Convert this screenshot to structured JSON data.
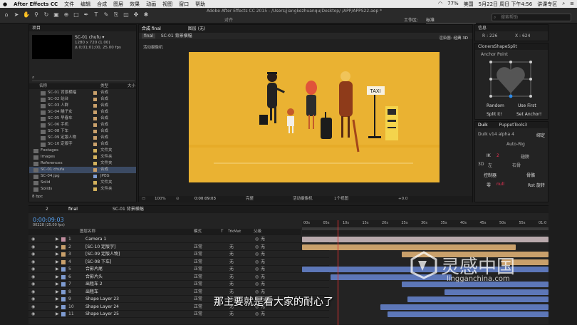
{
  "menubar": {
    "app": "After Effects CC",
    "items": [
      "文件",
      "编辑",
      "合成",
      "图层",
      "效果",
      "动画",
      "视图",
      "窗口",
      "帮助"
    ],
    "status": "77%",
    "lang": "美国",
    "datetime": "5月22日 周日 下午4:56",
    "user": "讲课专区"
  },
  "window_title": "Adobe After Effects CC 2015 - /Users/jiangkezhuanqu/Desktop/ /APP/APPS22.aep *",
  "toolbar": {
    "snap": "对齐",
    "workspace_label": "工作区:",
    "workspace": "标准",
    "search_placeholder": "搜索帮助"
  },
  "project": {
    "title": "项目",
    "comp_name": "SC-01 chufu ▾",
    "comp_info1": "1280 x 720 (1.00)",
    "comp_info2": "Δ 0;01;01;00, 25.00 fps",
    "col_name": "名称",
    "col_type": "类型",
    "col_size": "大小",
    "items": [
      {
        "name": "SC-01 背景横幅",
        "type": "合成",
        "color": "#c9a06b"
      },
      {
        "name": "SC-02 站台",
        "type": "合成",
        "color": "#c9a06b"
      },
      {
        "name": "SC-03 人群",
        "type": "合成",
        "color": "#c9a06b"
      },
      {
        "name": "SC-04 瞄子女",
        "type": "合成",
        "color": "#c9a06b"
      },
      {
        "name": "SC-05 早春车",
        "type": "合成",
        "color": "#c9a06b"
      },
      {
        "name": "SC-06 手机",
        "type": "合成",
        "color": "#c9a06b"
      },
      {
        "name": "SC-08 下车",
        "type": "合成",
        "color": "#c9a06b"
      },
      {
        "name": "SC-09 定版人物",
        "type": "合成",
        "color": "#c9a06b"
      },
      {
        "name": "SC-10 定版字",
        "type": "合成",
        "color": "#c9a06b"
      },
      {
        "name": "Footages",
        "type": "文件夹",
        "color": "#d2b15c"
      },
      {
        "name": "Images",
        "type": "文件夹",
        "color": "#d2b15c"
      },
      {
        "name": "References",
        "type": "文件夹",
        "color": "#d2b15c"
      },
      {
        "name": "SC-01 chufa",
        "type": "合成",
        "color": "#c9a06b"
      },
      {
        "name": "SC-04.jpg",
        "type": "JPEG",
        "color": "#7f9cd1"
      },
      {
        "name": "Solid",
        "type": "文件夹",
        "color": "#d2b15c"
      },
      {
        "name": "Solids",
        "type": "文件夹",
        "color": "#d2b15c"
      }
    ],
    "footer": "8 bpc"
  },
  "composition": {
    "tab_final": "final",
    "tab_label": "合成 final",
    "tab2": "图层 (无)",
    "sub_tab": "SC-01 背景横幅",
    "side_label": "活动摄像机",
    "renderer_label": "渲染器:",
    "renderer": "经典 3D",
    "taxi": "TAXI",
    "zoom": "100%",
    "timecode": "0:00:09:03",
    "quality": "完整",
    "camera": "活动摄像机",
    "views": "1个视图",
    "offset": "+0.0"
  },
  "info": {
    "title": "信息",
    "r": "R : 226",
    "x": "X : 624"
  },
  "shapesplit": {
    "title": "ClonersShapeSplit",
    "anchor": "Anchor Point",
    "random": "Random",
    "use_first": "Use First",
    "split_it": "Split it!",
    "set_anchor": "Set Anchor!"
  },
  "duik": {
    "tab1": "Duik",
    "tab2": "PuppetTools3",
    "version": "Duik v14 alpha 4",
    "bind": "绑定",
    "autorig": "Auto-Rig",
    "ik": "IK",
    "ik_val": "2",
    "wing": "翅膀",
    "threed": "3D",
    "left": "左",
    "right": "右骨",
    "controller": "控制器",
    "bone": "骨骼",
    "zero": "零",
    "zero_val": "null",
    "rot": "Rot 旋转"
  },
  "timeline": {
    "tabs": [
      "2",
      "final",
      "SC-01 背景横幅"
    ],
    "timecode": "0:00:09:03",
    "frames": "00228 (25.00 fps)",
    "col_layer": "图层名称",
    "col_mode": "模式",
    "col_t": "T",
    "col_trk": "TrkMat",
    "col_parent": "父级",
    "ruler": [
      "00s",
      "05s",
      "10s",
      "15s",
      "20s",
      "25s",
      "30s",
      "35s",
      "40s",
      "45s",
      "50s",
      "55s",
      "01:0"
    ],
    "layers": [
      {
        "num": "1",
        "name": "Camera 1",
        "color": "#c28ea0",
        "mode": "",
        "trk": "",
        "parent": "无"
      },
      {
        "num": "2",
        "name": "[SC-10 定版字]",
        "color": "#c9a06b",
        "mode": "正常",
        "trk": "无",
        "parent": "无"
      },
      {
        "num": "3",
        "name": "[SC-09 定版人物]",
        "color": "#c9a06b",
        "mode": "正常",
        "trk": "无",
        "parent": "无"
      },
      {
        "num": "4",
        "name": "[SC-08 下车]",
        "color": "#c9a06b",
        "mode": "正常",
        "trk": "无",
        "parent": "无"
      },
      {
        "num": "5",
        "name": "合影片尾",
        "color": "#7f9cd1",
        "mode": "正常",
        "trk": "无",
        "parent": "无"
      },
      {
        "num": "6",
        "name": "合影片头",
        "color": "#7f9cd1",
        "mode": "正常",
        "trk": "无",
        "parent": "无"
      },
      {
        "num": "7",
        "name": "出租车 2",
        "color": "#7f9cd1",
        "mode": "正常",
        "trk": "无",
        "parent": "无"
      },
      {
        "num": "8",
        "name": "出租车",
        "color": "#7f9cd1",
        "mode": "正常",
        "trk": "无",
        "parent": "无"
      },
      {
        "num": "9",
        "name": "Shape Layer 23",
        "color": "#7f9cd1",
        "mode": "正常",
        "trk": "无",
        "parent": "无"
      },
      {
        "num": "10",
        "name": "Shape Layer 24",
        "color": "#7f9cd1",
        "mode": "正常",
        "trk": "无",
        "parent": "无"
      },
      {
        "num": "11",
        "name": "Shape Layer 25",
        "color": "#7f9cd1",
        "mode": "正常",
        "trk": "无",
        "parent": "无"
      }
    ]
  },
  "subtitle": "那主要就是看大家的耐心了",
  "watermark": {
    "cn": "灵感中国",
    "en": "lingganchina.com"
  },
  "colors": {
    "accent": "#2d8ceb",
    "comp_bg": "#eab232",
    "timecode": "#55a0f0"
  }
}
